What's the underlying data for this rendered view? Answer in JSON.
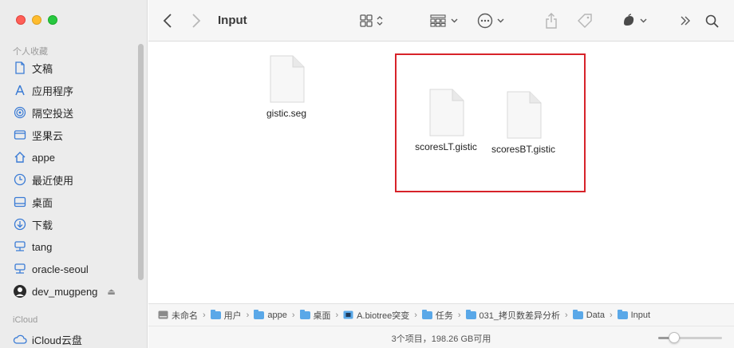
{
  "window": {
    "title": "Input"
  },
  "sidebar": {
    "favorites_title": "个人收藏",
    "items": [
      {
        "label": "文稿",
        "icon": "document-icon"
      },
      {
        "label": "应用程序",
        "icon": "applications-icon"
      },
      {
        "label": "隔空投送",
        "icon": "airdrop-icon"
      },
      {
        "label": "坚果云",
        "icon": "nutstore-icon"
      },
      {
        "label": "appe",
        "icon": "home-icon"
      },
      {
        "label": "最近使用",
        "icon": "recents-icon"
      },
      {
        "label": "桌面",
        "icon": "desktop-icon"
      },
      {
        "label": "下载",
        "icon": "downloads-icon"
      },
      {
        "label": "tang",
        "icon": "server-icon"
      },
      {
        "label": "oracle-seoul",
        "icon": "server-icon"
      },
      {
        "label": "dev_mugpeng",
        "icon": "avatar-icon"
      }
    ],
    "icloud_title": "iCloud",
    "icloud_item": {
      "label": "iCloud云盘",
      "icon": "icloud-icon"
    }
  },
  "files": [
    {
      "name": "gistic.seg"
    },
    {
      "name": "scoresLT.gistic"
    },
    {
      "name": "scoresBT.gistic"
    }
  ],
  "pathbar": [
    {
      "label": "未命名",
      "icon": "disk-icon"
    },
    {
      "label": "用户",
      "icon": "folder-icon"
    },
    {
      "label": "appe",
      "icon": "home-folder-icon"
    },
    {
      "label": "桌面",
      "icon": "folder-icon"
    },
    {
      "label": "A.biotree突变",
      "icon": "app-folder-icon"
    },
    {
      "label": "任务",
      "icon": "folder-icon"
    },
    {
      "label": "031_拷贝数差异分析",
      "icon": "folder-icon"
    },
    {
      "label": "Data",
      "icon": "folder-icon"
    },
    {
      "label": "Input",
      "icon": "folder-icon"
    }
  ],
  "status": {
    "text": "3个项目，198.26 GB可用",
    "zoom_fraction": 0.25
  },
  "colors": {
    "highlight": "#d7232a",
    "accent": "#3a7bd5"
  }
}
